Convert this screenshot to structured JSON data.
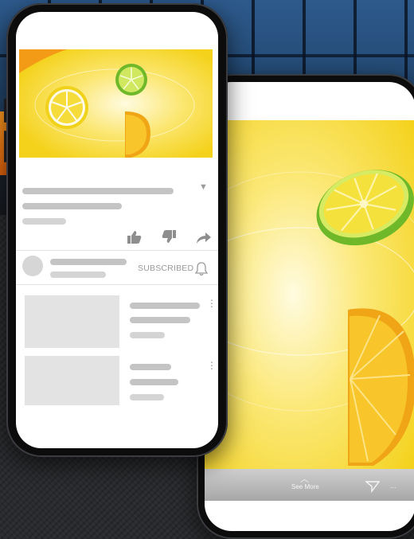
{
  "front_phone": {
    "channel": {
      "subscribed_label": "SUBSCRIBED"
    }
  },
  "back_phone": {
    "footer": {
      "see_more_label": "See More",
      "more_label": "..."
    }
  },
  "colors": {
    "lemon_yellow": "#f7d21a",
    "lime_green": "#7cc12a",
    "orange": "#f4a51c",
    "placeholder_grey": "#c4c4c4"
  },
  "icons": [
    "dropdown-caret-icon",
    "thumbs-up-icon",
    "thumbs-down-icon",
    "share-icon",
    "bell-icon",
    "more-vert-icon",
    "chevron-up-icon",
    "send-icon"
  ]
}
